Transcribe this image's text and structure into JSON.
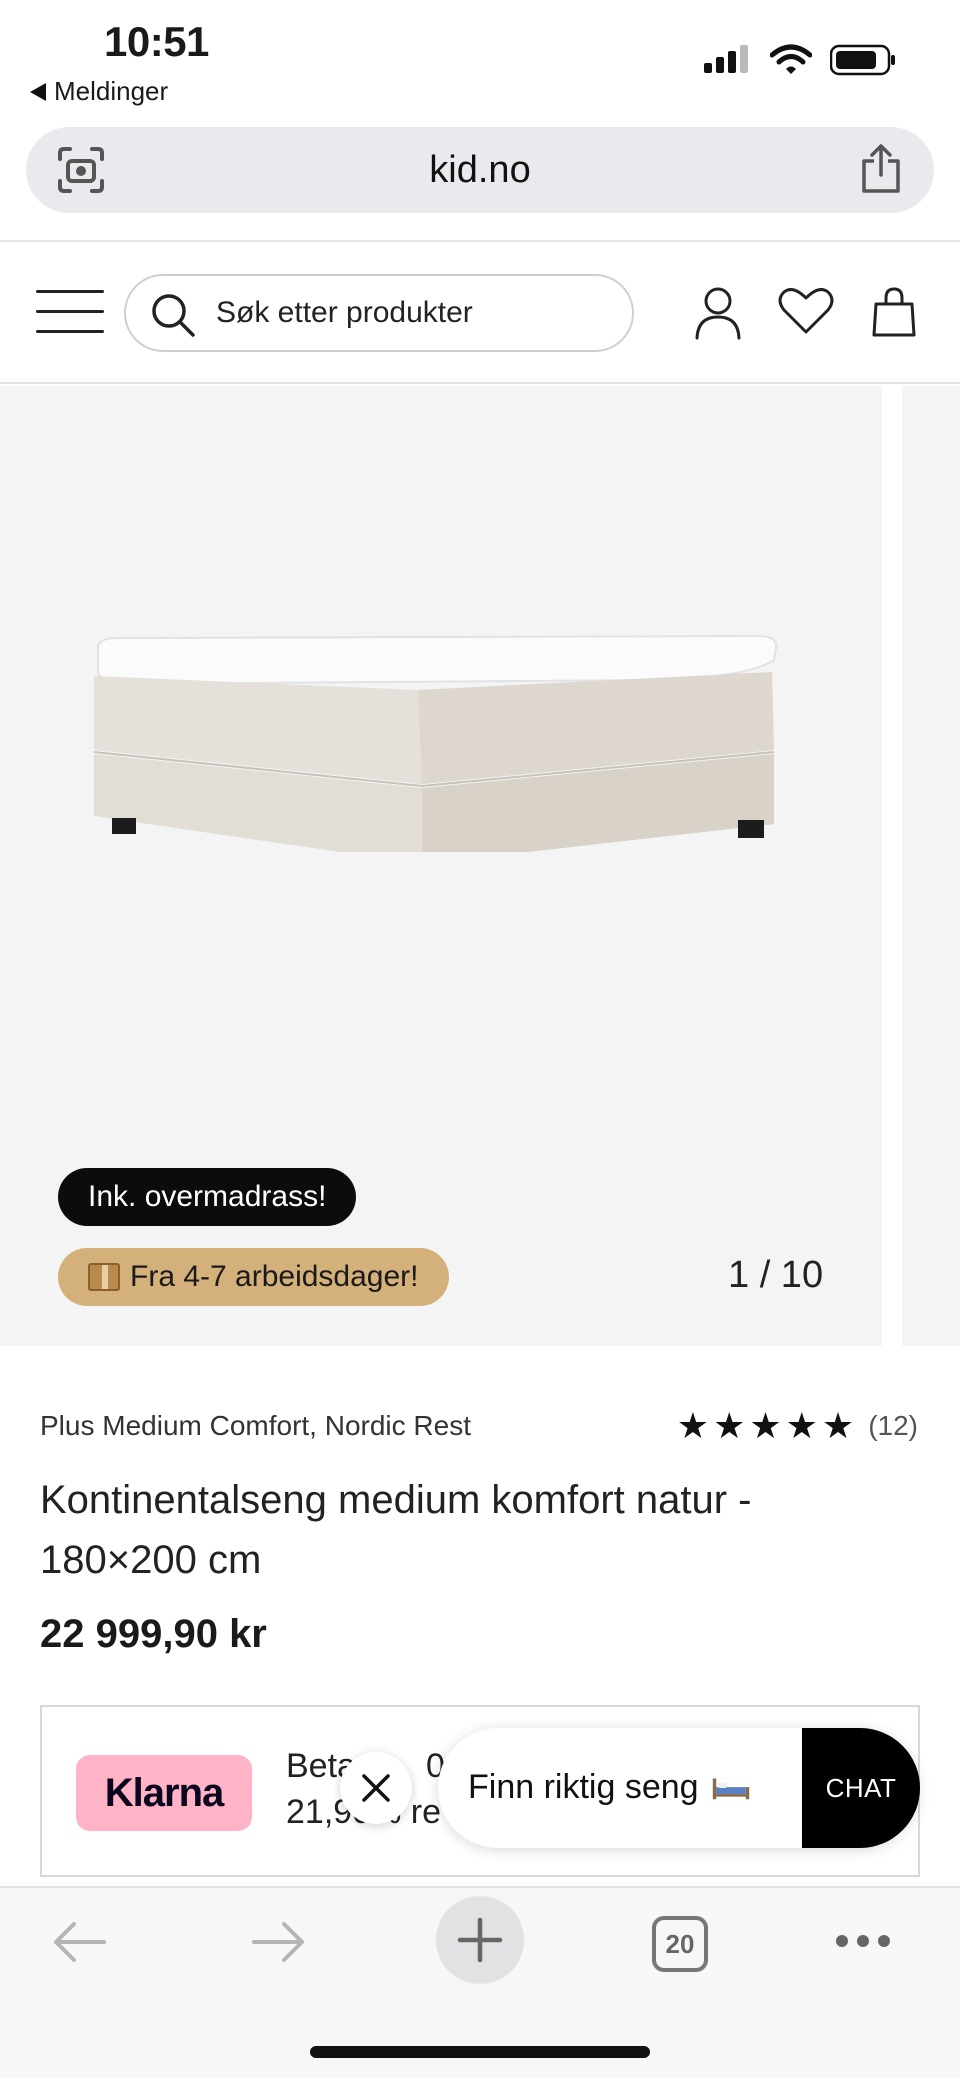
{
  "status_bar": {
    "time": "10:51",
    "back_app_label": "Meldinger",
    "icons": [
      "signal-icon",
      "wifi-icon",
      "battery-icon"
    ]
  },
  "browser": {
    "url": "kid.no",
    "left_icon": "visual-lookup-icon",
    "right_icon": "share-icon"
  },
  "header": {
    "menu_icon": "hamburger-icon",
    "search_placeholder": "Søk etter produkter",
    "icons": [
      "account-icon",
      "wishlist-heart-icon",
      "cart-bag-icon"
    ]
  },
  "gallery": {
    "badge_primary": "Ink. overmadrass!",
    "badge_delivery": "Fra 4-7 arbeidsdager!",
    "delivery_icon": "package-icon",
    "counter": "1 / 10"
  },
  "product": {
    "brand": "Plus Medium Comfort, Nordic Rest",
    "rating_stars": 5,
    "rating_count": "(12)",
    "title": "Kontinentalseng medium komfort natur - 180×200 cm",
    "price": "22 999,90 kr"
  },
  "klarna": {
    "logo": "Klarna",
    "line1": "Beta",
    "line1_fragment": "0",
    "line2": "21,90",
    "line2_fragment": "% re"
  },
  "chat": {
    "prompt": "Finn riktig seng",
    "button": "CHAT",
    "close_icon": "close-icon"
  },
  "toolbar": {
    "tab_count": "20",
    "icons": [
      "back-arrow-icon",
      "forward-arrow-icon",
      "new-tab-plus-icon",
      "tabs-icon",
      "more-dots-icon"
    ]
  },
  "colors": {
    "badge_black": "#0c0c0c",
    "badge_tan": "#d4b07a",
    "klarna_pink": "#ffb3c7",
    "gallery_bg": "#f4f4f5"
  }
}
